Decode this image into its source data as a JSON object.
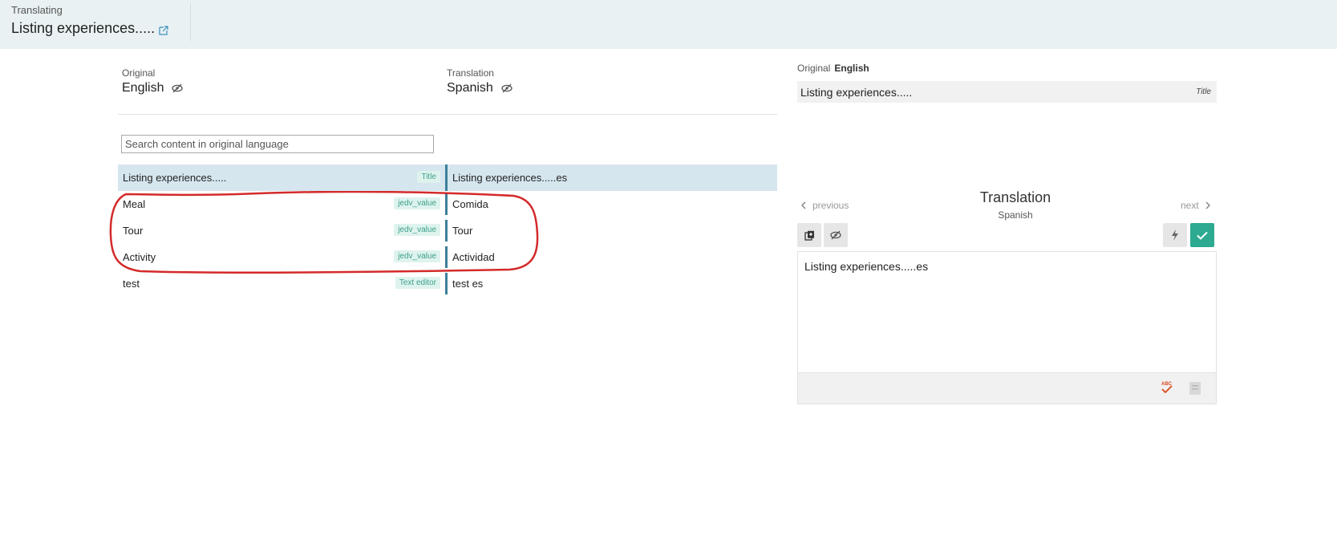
{
  "header": {
    "subtitle": "Translating",
    "title": "Listing experiences....."
  },
  "languages": {
    "original_label": "Original",
    "original_lang": "English",
    "translation_label": "Translation",
    "translation_lang": "Spanish"
  },
  "search": {
    "placeholder": "Search content in original language"
  },
  "rows": [
    {
      "original": "Listing experiences.....",
      "tag": "Title",
      "translation": "Listing experiences.....es"
    },
    {
      "original": "Meal",
      "tag": "jedv_value",
      "translation": "Comida"
    },
    {
      "original": "Tour",
      "tag": "jedv_value",
      "translation": "Tour"
    },
    {
      "original": "Activity",
      "tag": "jedv_value",
      "translation": "Actividad"
    },
    {
      "original": "test",
      "tag": "Text editor",
      "translation": "test es"
    }
  ],
  "right_panel": {
    "original_label": "Original",
    "original_lang": "English",
    "original_text": "Listing experiences.....",
    "original_tag": "Title",
    "prev_label": "previous",
    "next_label": "next",
    "translation_title": "Translation",
    "translation_lang": "Spanish",
    "editor_text": "Listing experiences.....es"
  },
  "colors": {
    "header_bg": "#e9f1f3",
    "selected_row": "#d6e6ef",
    "accent_bar": "#3d7f9a",
    "tag_text": "#3da08a",
    "confirm_button": "#2daa91",
    "annotation": "#d42a2a"
  }
}
